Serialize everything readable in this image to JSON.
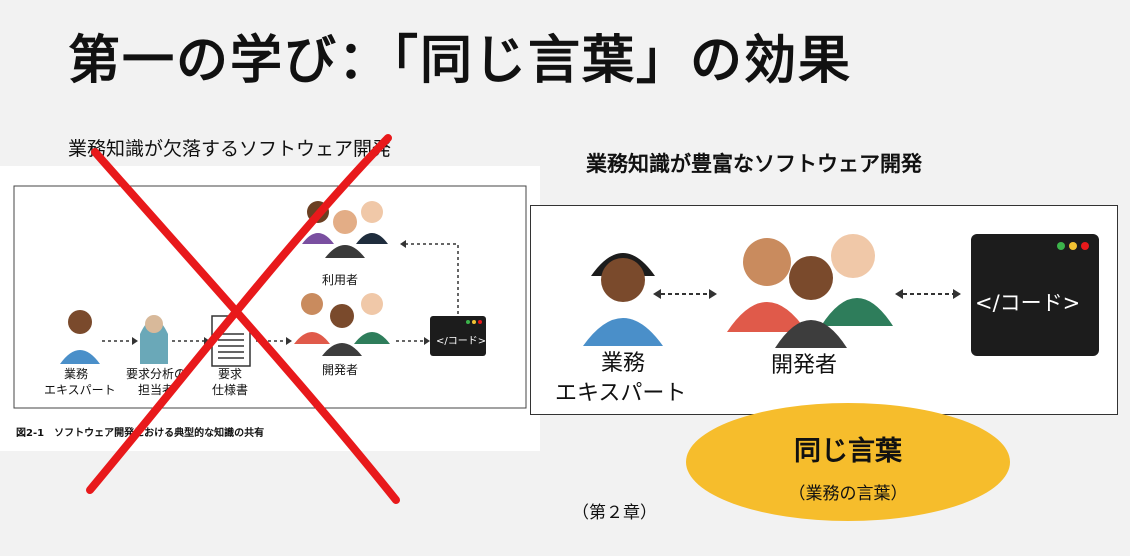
{
  "title": "第一の学び：「同じ言葉」の効果",
  "left": {
    "caption": "業務知識が欠落するソフトウェア開発",
    "users_label": "利用者",
    "expert_label_1": "業務",
    "expert_label_2": "エキスパート",
    "analyst_label_1": "要求分析の",
    "analyst_label_2": "担当者",
    "spec_label_1": "要求",
    "spec_label_2": "仕様書",
    "devs_label": "開発者",
    "code_label": "</コード>",
    "figure_caption": "図2-1　ソフトウェア開発における典型的な知識の共有"
  },
  "right": {
    "caption": "業務知識が豊富なソフトウェア開発",
    "expert_label_1": "業務",
    "expert_label_2": "エキスパート",
    "devs_label": "開発者",
    "code_label": "</コード>"
  },
  "callout": {
    "title": "同じ言葉",
    "subtitle": "（業務の言葉）"
  },
  "chapter_note": "（第２章）",
  "colors": {
    "cross": "#e8191b",
    "callout": "#f6bd2c",
    "terminal": "#1c1c1c"
  }
}
